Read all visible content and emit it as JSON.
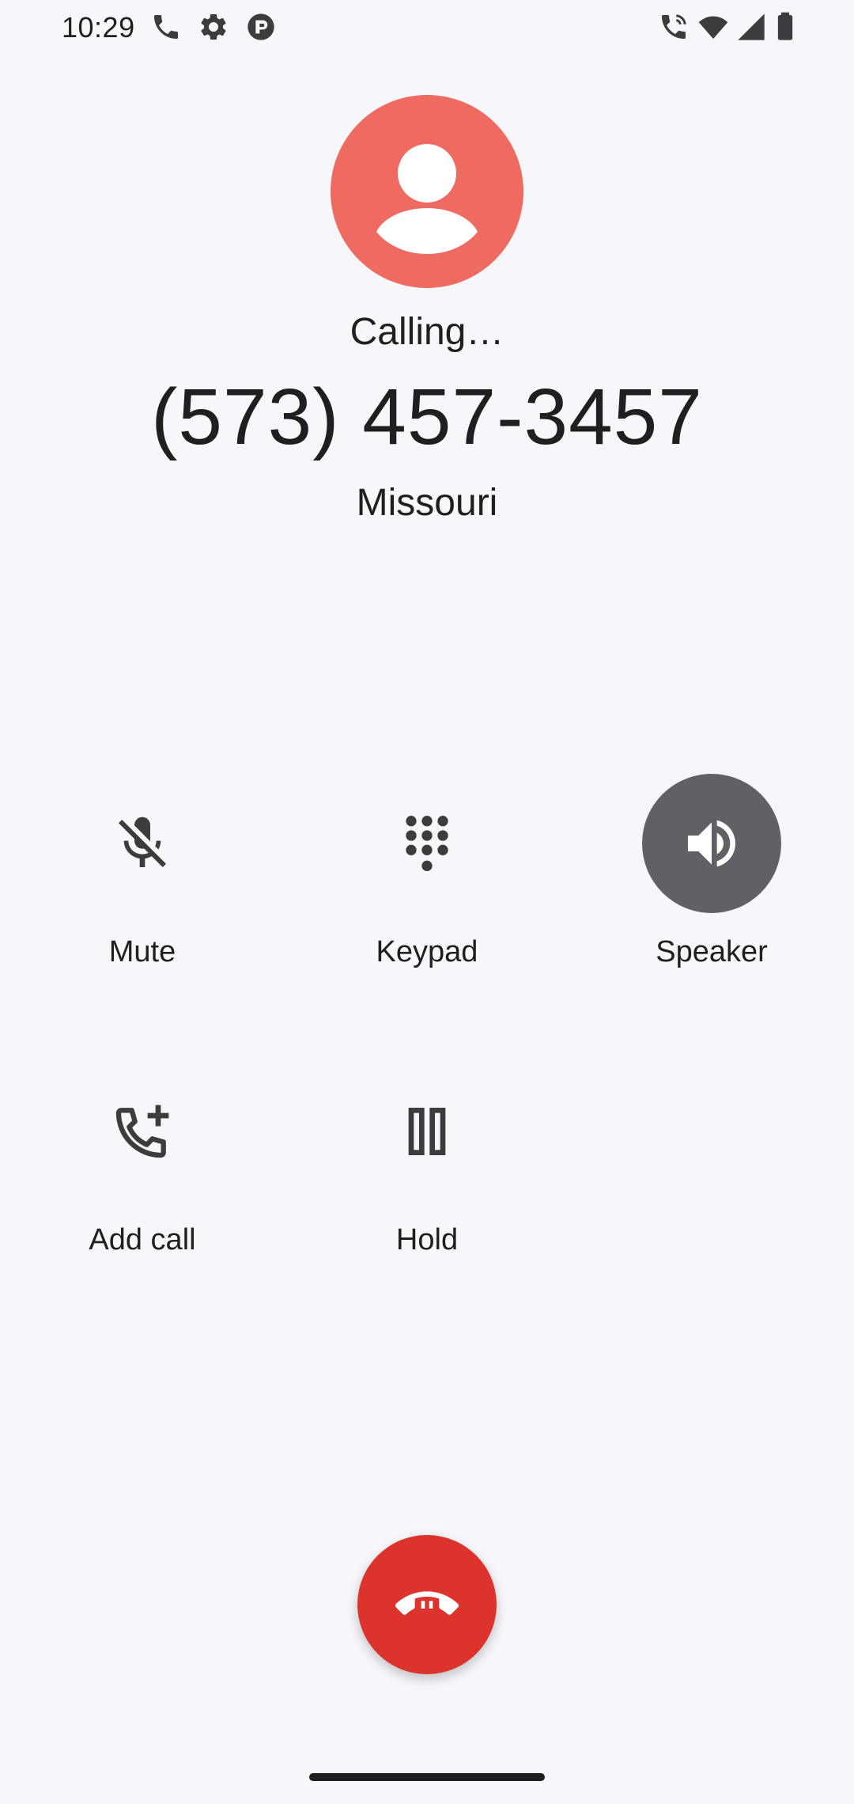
{
  "status_bar": {
    "time": "10:29",
    "left_icons": [
      "phone-icon",
      "settings-icon",
      "app-sync-icon"
    ],
    "right_icons": [
      "wifi-calling-icon",
      "wifi-icon",
      "cell-signal-icon",
      "battery-icon"
    ]
  },
  "call": {
    "status": "Calling…",
    "number": "(573) 457-3457",
    "location": "Missouri",
    "avatar_color": "#ef6a60"
  },
  "controls": {
    "mute_label": "Mute",
    "keypad_label": "Keypad",
    "speaker_label": "Speaker",
    "speaker_active": true,
    "add_call_label": "Add call",
    "hold_label": "Hold"
  },
  "end_call": {
    "icon": "end-call-icon",
    "color": "#dc342d"
  }
}
